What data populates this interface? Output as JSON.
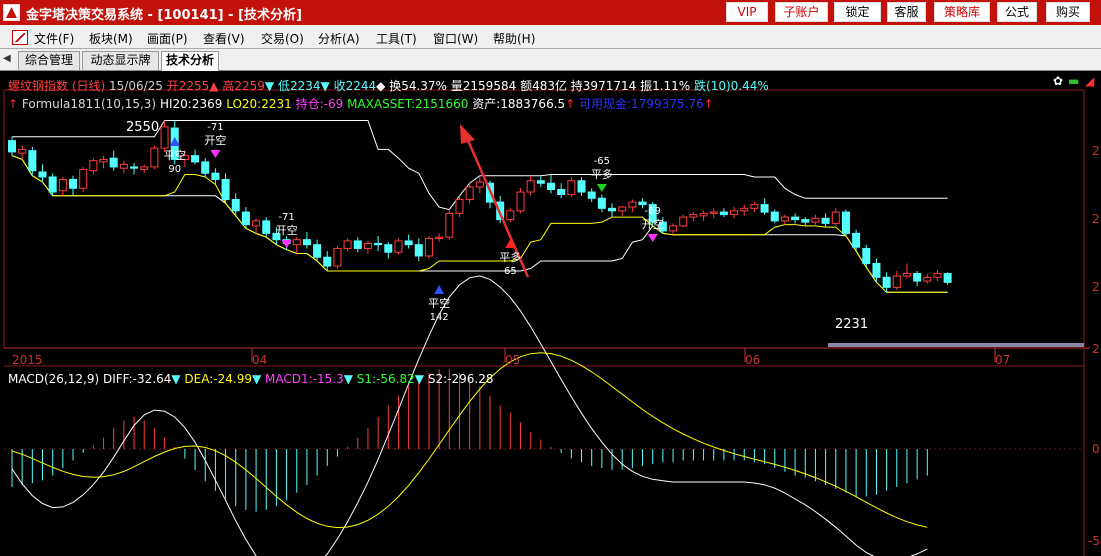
{
  "titlebar": {
    "title": "金字塔决策交易系统 - [100141] - [技术分析]",
    "buttons": [
      "VIP",
      "子账户",
      "锁定",
      "客服",
      "策略库",
      "公式",
      "购买"
    ]
  },
  "menubar": {
    "items": [
      "文件(F)",
      "板块(M)",
      "画面(P)",
      "查看(V)",
      "交易(O)",
      "分析(A)",
      "工具(T)",
      "窗口(W)",
      "帮助(H)"
    ]
  },
  "tabs": [
    "综合管理",
    "动态显示牌",
    "技术分析"
  ],
  "info_row1": {
    "name": "螺纹钢指数 (日线)",
    "date": "15/06/25",
    "open": "开2255",
    "high": "高2259",
    "low": "低2234",
    "close": "收2244",
    "turnover": "换54.37%",
    "volume": "量2159584",
    "amount": "额483亿",
    "oi": "持3971714",
    "amplitude": "振1.11%",
    "change": "跌(10)0.44%"
  },
  "info_row2": {
    "formula": "Formula1811(10,15,3)",
    "hi20": "HI20:2369",
    "lo20": "LO20:2231",
    "position": "持仓:-69",
    "maxasset": "MAXASSET:2151660",
    "asset": "资产:1883766.5",
    "cash": "可用现金:1799375.76"
  },
  "macd_row": {
    "name": "MACD(26,12,9)",
    "diff": "DIFF:-32.64",
    "dea": "DEA:-24.99",
    "macd1": "MACD1:-15.3",
    "s1": "S1:-56.82",
    "s2": "S2:-296.28"
  },
  "price_labels": {
    "high": "2550",
    "low": "2231"
  },
  "signals": [
    {
      "text": "开空",
      "num": "-71"
    },
    {
      "text": "开空",
      "num": "-71"
    },
    {
      "text": "平空",
      "num": "90"
    },
    {
      "text": "平空",
      "num": "142"
    },
    {
      "text": "平多",
      "num": "65"
    },
    {
      "text": "平多",
      "num": "-65"
    },
    {
      "text": "开空",
      "num": "-69"
    }
  ],
  "time_axis": [
    "2015",
    "04",
    "05",
    "06",
    "07"
  ],
  "right_axis": {
    "price_ticks": [
      "2",
      "2",
      "2",
      "2"
    ],
    "macd_ticks": [
      "0",
      "-5"
    ]
  },
  "colors": {
    "up": "#ff3c3c",
    "down": "#54ffff",
    "title_bar": "#c2120b",
    "hi_lo": "#ffffff",
    "stop_line": "#ffff00",
    "arrow": "#e53030"
  },
  "chart_data": {
    "type": "candlestick",
    "x_labels": [
      "2015",
      "04",
      "05",
      "06",
      "07"
    ],
    "ohlc": [
      [
        2528,
        2534,
        2504,
        2510
      ],
      [
        2508,
        2520,
        2498,
        2514
      ],
      [
        2512,
        2518,
        2472,
        2480
      ],
      [
        2478,
        2490,
        2462,
        2470
      ],
      [
        2470,
        2476,
        2440,
        2446
      ],
      [
        2448,
        2470,
        2440,
        2466
      ],
      [
        2466,
        2472,
        2440,
        2452
      ],
      [
        2452,
        2486,
        2446,
        2482
      ],
      [
        2480,
        2500,
        2474,
        2496
      ],
      [
        2494,
        2504,
        2484,
        2498
      ],
      [
        2500,
        2512,
        2480,
        2486
      ],
      [
        2484,
        2496,
        2476,
        2490
      ],
      [
        2486,
        2492,
        2474,
        2484
      ],
      [
        2482,
        2490,
        2476,
        2486
      ],
      [
        2486,
        2520,
        2482,
        2516
      ],
      [
        2516,
        2560,
        2510,
        2550
      ],
      [
        2548,
        2560,
        2490,
        2498
      ],
      [
        2498,
        2512,
        2486,
        2504
      ],
      [
        2504,
        2514,
        2490,
        2494
      ],
      [
        2494,
        2500,
        2470,
        2476
      ],
      [
        2476,
        2484,
        2458,
        2466
      ],
      [
        2466,
        2476,
        2428,
        2434
      ],
      [
        2434,
        2444,
        2408,
        2416
      ],
      [
        2414,
        2422,
        2388,
        2394
      ],
      [
        2392,
        2404,
        2380,
        2400
      ],
      [
        2400,
        2406,
        2374,
        2380
      ],
      [
        2380,
        2390,
        2362,
        2370
      ],
      [
        2370,
        2376,
        2354,
        2364
      ],
      [
        2362,
        2374,
        2348,
        2370
      ],
      [
        2370,
        2382,
        2356,
        2362
      ],
      [
        2362,
        2370,
        2336,
        2342
      ],
      [
        2342,
        2352,
        2320,
        2328
      ],
      [
        2328,
        2360,
        2324,
        2356
      ],
      [
        2356,
        2372,
        2352,
        2368
      ],
      [
        2368,
        2374,
        2350,
        2356
      ],
      [
        2356,
        2368,
        2348,
        2364
      ],
      [
        2364,
        2376,
        2352,
        2362
      ],
      [
        2362,
        2366,
        2340,
        2350
      ],
      [
        2350,
        2372,
        2346,
        2368
      ],
      [
        2368,
        2378,
        2356,
        2362
      ],
      [
        2362,
        2372,
        2336,
        2344
      ],
      [
        2344,
        2376,
        2340,
        2372
      ],
      [
        2372,
        2380,
        2366,
        2374
      ],
      [
        2374,
        2418,
        2370,
        2412
      ],
      [
        2412,
        2440,
        2406,
        2434
      ],
      [
        2434,
        2460,
        2428,
        2454
      ],
      [
        2454,
        2472,
        2444,
        2462
      ],
      [
        2460,
        2464,
        2420,
        2430
      ],
      [
        2430,
        2440,
        2396,
        2402
      ],
      [
        2402,
        2420,
        2398,
        2416
      ],
      [
        2416,
        2452,
        2412,
        2446
      ],
      [
        2446,
        2472,
        2440,
        2464
      ],
      [
        2464,
        2472,
        2454,
        2460
      ],
      [
        2460,
        2474,
        2444,
        2450
      ],
      [
        2450,
        2460,
        2436,
        2442
      ],
      [
        2442,
        2470,
        2438,
        2464
      ],
      [
        2464,
        2470,
        2440,
        2446
      ],
      [
        2446,
        2452,
        2430,
        2436
      ],
      [
        2436,
        2442,
        2414,
        2420
      ],
      [
        2420,
        2428,
        2406,
        2416
      ],
      [
        2416,
        2424,
        2408,
        2422
      ],
      [
        2422,
        2434,
        2414,
        2430
      ],
      [
        2430,
        2436,
        2420,
        2426
      ],
      [
        2426,
        2430,
        2392,
        2398
      ],
      [
        2398,
        2406,
        2380,
        2384
      ],
      [
        2384,
        2396,
        2378,
        2392
      ],
      [
        2392,
        2410,
        2390,
        2406
      ],
      [
        2406,
        2414,
        2400,
        2410
      ],
      [
        2408,
        2416,
        2400,
        2412
      ],
      [
        2412,
        2420,
        2404,
        2414
      ],
      [
        2414,
        2420,
        2406,
        2410
      ],
      [
        2410,
        2422,
        2404,
        2416
      ],
      [
        2416,
        2426,
        2408,
        2420
      ],
      [
        2420,
        2430,
        2414,
        2426
      ],
      [
        2426,
        2436,
        2410,
        2414
      ],
      [
        2414,
        2418,
        2396,
        2400
      ],
      [
        2400,
        2410,
        2394,
        2406
      ],
      [
        2406,
        2412,
        2396,
        2402
      ],
      [
        2402,
        2406,
        2392,
        2398
      ],
      [
        2398,
        2410,
        2394,
        2404
      ],
      [
        2404,
        2412,
        2390,
        2396
      ],
      [
        2396,
        2420,
        2392,
        2414
      ],
      [
        2414,
        2418,
        2376,
        2380
      ],
      [
        2380,
        2386,
        2352,
        2358
      ],
      [
        2356,
        2362,
        2326,
        2332
      ],
      [
        2332,
        2340,
        2302,
        2310
      ],
      [
        2310,
        2318,
        2286,
        2294
      ],
      [
        2294,
        2320,
        2290,
        2312
      ],
      [
        2312,
        2332,
        2308,
        2316
      ],
      [
        2316,
        2320,
        2296,
        2304
      ],
      [
        2304,
        2316,
        2300,
        2310
      ],
      [
        2310,
        2322,
        2304,
        2316
      ],
      [
        2316,
        2318,
        2298,
        2302
      ]
    ],
    "hi20_last": 2369,
    "lo20_last": 2231,
    "macd_hist": [
      -40,
      -38,
      -36,
      -33,
      -28,
      -20,
      -12,
      -4,
      4,
      12,
      22,
      30,
      34,
      30,
      22,
      12,
      2,
      -10,
      -22,
      -34,
      -44,
      -52,
      -60,
      -64,
      -66,
      -64,
      -60,
      -54,
      -46,
      -38,
      -28,
      -18,
      -8,
      2,
      12,
      22,
      34,
      46,
      56,
      66,
      74,
      80,
      84,
      84,
      80,
      74,
      66,
      56,
      46,
      38,
      28,
      18,
      10,
      2,
      -4,
      -10,
      -14,
      -18,
      -20,
      -22,
      -22,
      -20,
      -18,
      -16,
      -14,
      -14,
      -12,
      -12,
      -12,
      -12,
      -12,
      -12,
      -12,
      -14,
      -16,
      -20,
      -24,
      -28,
      -30,
      -34,
      -38,
      -42,
      -46,
      -50,
      -50,
      -48,
      -44,
      -40,
      -36,
      -32,
      -28
    ]
  }
}
